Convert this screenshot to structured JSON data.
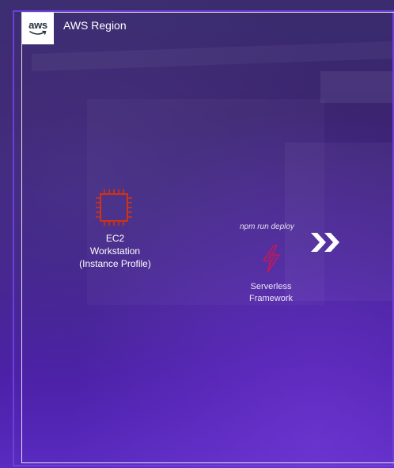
{
  "region": {
    "label": "AWS Region",
    "logo_text": "aws",
    "border_color": "#ffffff",
    "frame_color": "#6b3fd8"
  },
  "ec2": {
    "icon": "ec2-instance-chip-icon",
    "icon_color": "#d13212",
    "label_lines": [
      "EC2",
      "Workstation",
      "(Instance Profile)"
    ]
  },
  "deploy": {
    "command": "npm run deploy",
    "arrow_icon": "double-chevron-right-icon"
  },
  "serverless": {
    "icon": "serverless-lightning-icon",
    "icon_color": "#c2185b",
    "label_lines": [
      "Serverless",
      "Framework"
    ]
  }
}
